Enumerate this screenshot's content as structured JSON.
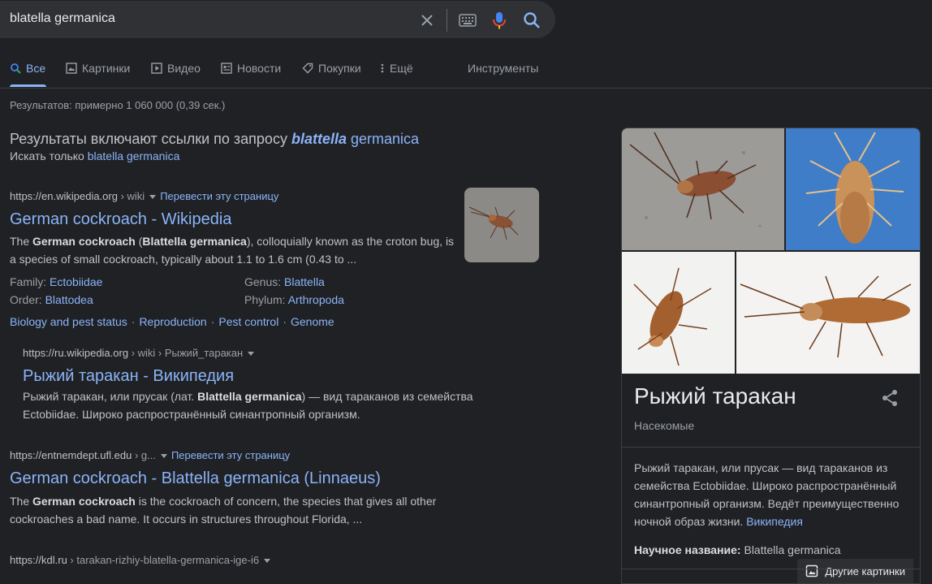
{
  "search": {
    "query": "blatella germanica",
    "icons": [
      "close-icon",
      "keyboard-icon",
      "mic-icon",
      "search-icon"
    ]
  },
  "tabs": [
    {
      "label": "Все",
      "icon": "search-icon",
      "active": true
    },
    {
      "label": "Картинки",
      "icon": "image-icon"
    },
    {
      "label": "Видео",
      "icon": "play-icon"
    },
    {
      "label": "Новости",
      "icon": "news-icon"
    },
    {
      "label": "Покупки",
      "icon": "tag-icon"
    },
    {
      "label": "Ещё",
      "icon": "more-vert-icon"
    },
    {
      "label": "Инструменты"
    }
  ],
  "stats": "Результатов: примерно 1 060 000 (0,39 сек.)",
  "correction": {
    "prefix": "Результаты включают ссылки по запросу ",
    "term_bold": "blattella",
    "term_rest": " germanica",
    "sub_prefix": "Искать только ",
    "sub_link": "blatella germanica"
  },
  "results": [
    {
      "domain": "https://en.wikipedia.org",
      "crumb": " › wiki",
      "translate": "Перевести эту страницу",
      "title": "German cockroach - Wikipedia",
      "snippet_parts": [
        "The ",
        "German cockroach",
        " (",
        "Blattella germanica",
        "), colloquially known as the croton bug, is",
        "a species of small cockroach, typically about 1.1 to 1.6 cm (0.43 to ..."
      ],
      "facts": [
        {
          "label": "Family:",
          "value": "Ectobiidae"
        },
        {
          "label": "Genus:",
          "value": "Blattella"
        },
        {
          "label": "Order:",
          "value": "Blattodea"
        },
        {
          "label": "Phylum:",
          "value": "Arthropoda"
        }
      ],
      "sitelinks": [
        "Biology and pest status",
        "Reproduction",
        "Pest control",
        "Genome"
      ]
    },
    {
      "domain": "https://ru.wikipedia.org",
      "crumb": " › wiki › Рыжий_таракан",
      "title": "Рыжий таракан - Википедия",
      "snippet_parts": [
        "Рыжий таракан, или прусак (лат. ",
        "Blattella germanica",
        ") — вид тараканов из семейства",
        "Ectobiidae. Широко распространённый синантропный организм."
      ]
    },
    {
      "domain": "https://entnemdept.ufl.edu",
      "crumb": " › g...",
      "translate": "Перевести эту страницу",
      "title": "German cockroach - Blattella germanica (Linnaeus)",
      "snippet_parts": [
        "The ",
        "German cockroach",
        " is the cockroach of concern, the species that gives all other",
        "cockroaches a bad name. It occurs in structures throughout Florida, ..."
      ]
    },
    {
      "domain": "https://kdl.ru",
      "crumb": " › tarakan-rizhiy-blatella-germanica-ige-i6"
    }
  ],
  "panel": {
    "more_images": "Другие картинки",
    "title": "Рыжий таракан",
    "subtitle": "Насекомые",
    "description": "Рыжий таракан, или прусак — вид тараканов из семейства Ectobiidae. Широко распространённый синантропный организм. Ведёт преимущественно ночной образ жизни.",
    "source": "Википедия",
    "sci_label": "Научное название:",
    "sci_value": "Blattella germanica"
  },
  "colors": {
    "background": "#202124",
    "link": "#8ab4f8",
    "text": "#bdc1c6",
    "muted": "#9aa0a6"
  }
}
